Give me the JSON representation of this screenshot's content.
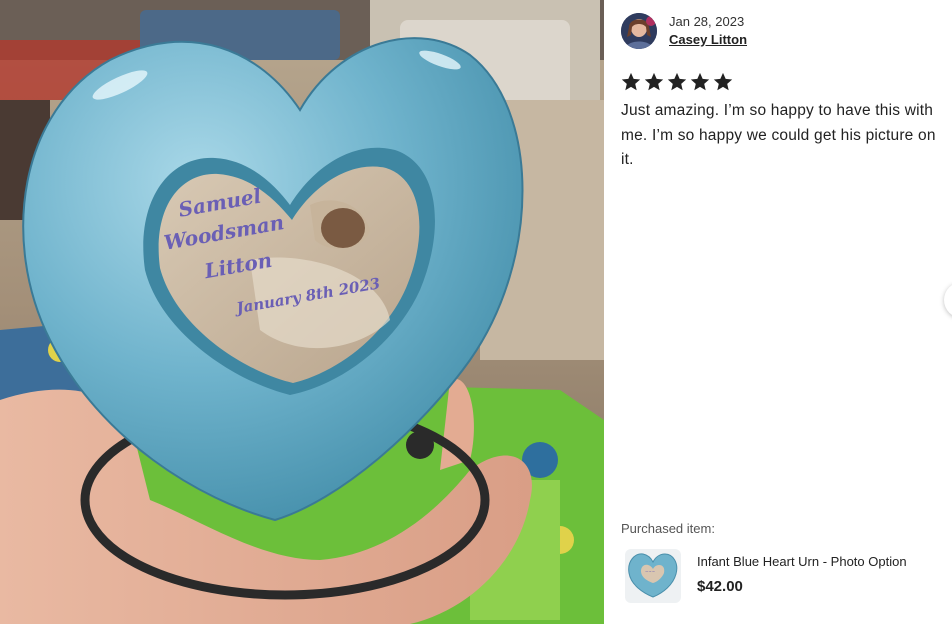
{
  "review": {
    "date": "Jan 28, 2023",
    "author": "Casey Litton",
    "rating": 5,
    "rating_max": 5,
    "text": "Just amazing. I’m so happy to have this with me. I’m so happy we could get his picture on it."
  },
  "photo": {
    "caption_lines": [
      "Samuel",
      "Woodsman",
      "Litton"
    ],
    "caption_date": "January 8th 2023"
  },
  "purchase": {
    "label": "Purchased item:",
    "name": "Infant Blue Heart Urn - Photo Option",
    "price": "$42.00"
  },
  "icons": {
    "star": "star-icon",
    "next": "chevron-right-icon"
  },
  "colors": {
    "star": "#222222",
    "urn_blue": "#6fb3cc"
  }
}
